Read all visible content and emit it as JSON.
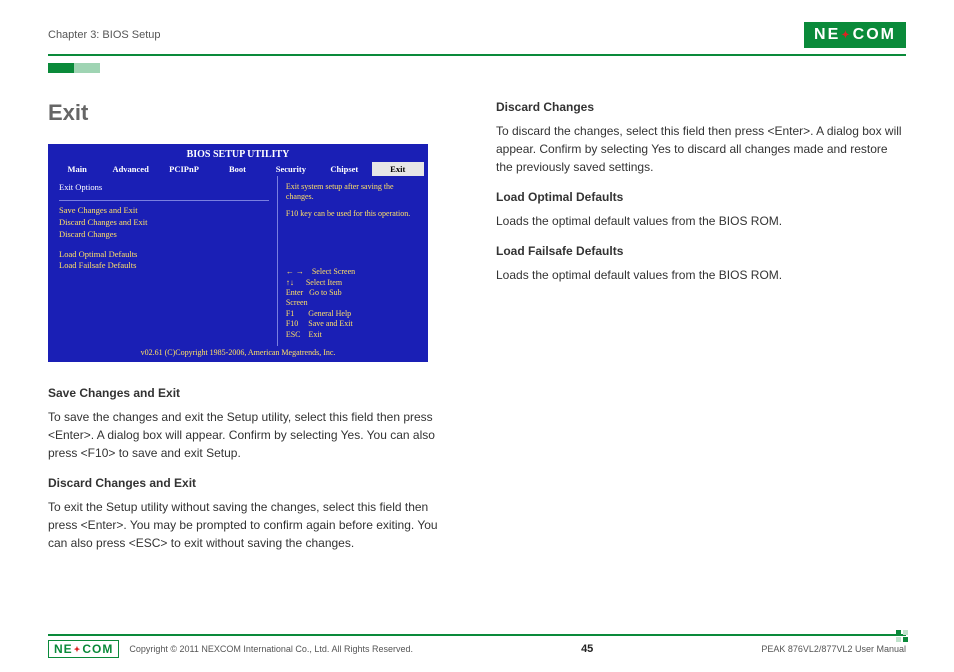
{
  "header": {
    "chapter": "Chapter 3: BIOS Setup",
    "logo_text_left": "NE",
    "logo_text_right": "COM"
  },
  "left": {
    "heading": "Exit",
    "bios": {
      "title": "BIOS SETUP UTILITY",
      "tabs": [
        "Main",
        "Advanced",
        "PCIPnP",
        "Boot",
        "Security",
        "Chipset",
        "Exit"
      ],
      "active_tab": "Exit",
      "options_header": "Exit Options",
      "group1": [
        "Save Changes and Exit",
        "Discard Changes and Exit",
        "Discard Changes"
      ],
      "group2": [
        "Load Optimal Defaults",
        "Load Failsafe Defaults"
      ],
      "hint1": "Exit system setup after saving the changes.",
      "hint2": "F10 key can be used for this operation.",
      "keys": [
        "← →    Select Screen",
        "↑↓      Select Item",
        "Enter   Go to Sub",
        "Screen",
        "F1       General Help",
        "F10     Save and Exit",
        "ESC    Exit"
      ],
      "footer": "v02.61 (C)Copyright 1985-2006, American Megatrends, Inc."
    },
    "s1_head": "Save Changes and Exit",
    "s1_body": "To save the changes and exit the Setup utility, select this field then press <Enter>. A dialog box will appear. Confirm by selecting Yes. You can also press <F10> to save and exit Setup.",
    "s2_head": "Discard Changes and Exit",
    "s2_body": "To exit the Setup utility without saving the changes, select this field then press <Enter>. You may be prompted to confirm again before exiting. You can also press <ESC> to exit without saving the changes."
  },
  "right": {
    "s3_head": "Discard Changes",
    "s3_body": "To discard the changes, select this field then press <Enter>. A dialog box will appear. Confirm by selecting Yes to discard all changes made and restore the previously saved settings.",
    "s4_head": "Load Optimal Defaults",
    "s4_body": "Loads the optimal default values from the BIOS ROM.",
    "s5_head": "Load Failsafe Defaults",
    "s5_body": "Loads the optimal default values from the BIOS ROM."
  },
  "footer": {
    "copyright": "Copyright © 2011 NEXCOM International Co., Ltd. All Rights Reserved.",
    "page": "45",
    "manual": "PEAK 876VL2/877VL2 User Manual"
  }
}
